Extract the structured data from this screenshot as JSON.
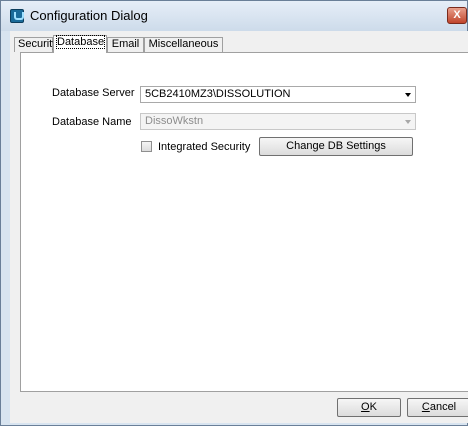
{
  "window": {
    "title": "Configuration Dialog",
    "close_label": "X"
  },
  "tabs": [
    {
      "label": "Security",
      "active": false
    },
    {
      "label": "Database",
      "active": true
    },
    {
      "label": "Email",
      "active": false
    },
    {
      "label": "Miscellaneous",
      "active": false
    }
  ],
  "database": {
    "server_label": "Database Server",
    "server_value": "5CB2410MZ3\\DISSOLUTION",
    "name_label": "Database Name",
    "name_value": "DissoWkstn",
    "integrated_security_label": "Integrated Security",
    "integrated_security_checked": false,
    "change_settings_button": "Change DB Settings"
  },
  "footer": {
    "ok_mnemonic": "O",
    "ok_rest": "K",
    "cancel_mnemonic": "C",
    "cancel_rest": "ancel"
  }
}
